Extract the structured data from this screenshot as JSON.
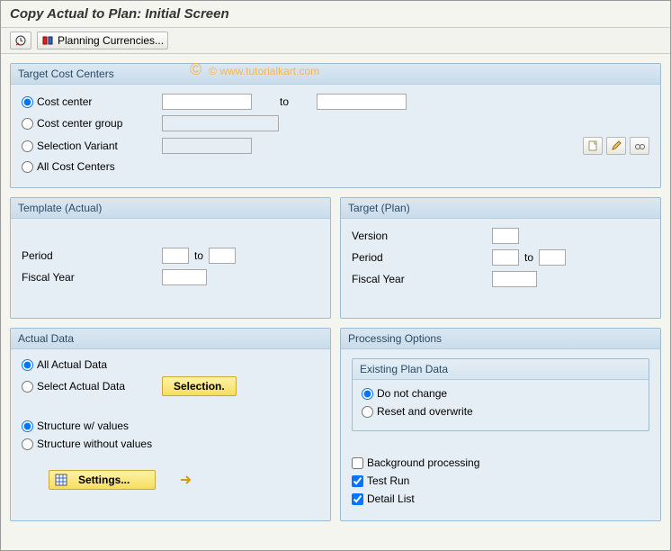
{
  "title": "Copy Actual to Plan: Initial Screen",
  "toolbar": {
    "planning_currencies": "Planning Currencies..."
  },
  "watermark": "© www.tutorialkart.com",
  "target_cost_centers": {
    "title": "Target Cost Centers",
    "cost_center": "Cost center",
    "cost_center_group": "Cost center group",
    "selection_variant": "Selection Variant",
    "all_cost_centers": "All Cost Centers",
    "to": "to"
  },
  "template_actual": {
    "title": "Template (Actual)",
    "period": "Period",
    "to": "to",
    "fiscal_year": "Fiscal Year"
  },
  "target_plan": {
    "title": "Target (Plan)",
    "version": "Version",
    "period": "Period",
    "to": "to",
    "fiscal_year": "Fiscal Year"
  },
  "actual_data": {
    "title": "Actual Data",
    "all": "All Actual Data",
    "select": "Select Actual Data",
    "selection_btn": "Selection.",
    "struct_with": "Structure w/ values",
    "struct_without": "Structure without values",
    "settings_btn": "Settings..."
  },
  "processing": {
    "title": "Processing Options",
    "existing_title": "Existing Plan Data",
    "do_not_change": "Do not change",
    "reset_overwrite": "Reset and overwrite",
    "background": "Background processing",
    "test_run": "Test Run",
    "detail_list": "Detail List"
  }
}
